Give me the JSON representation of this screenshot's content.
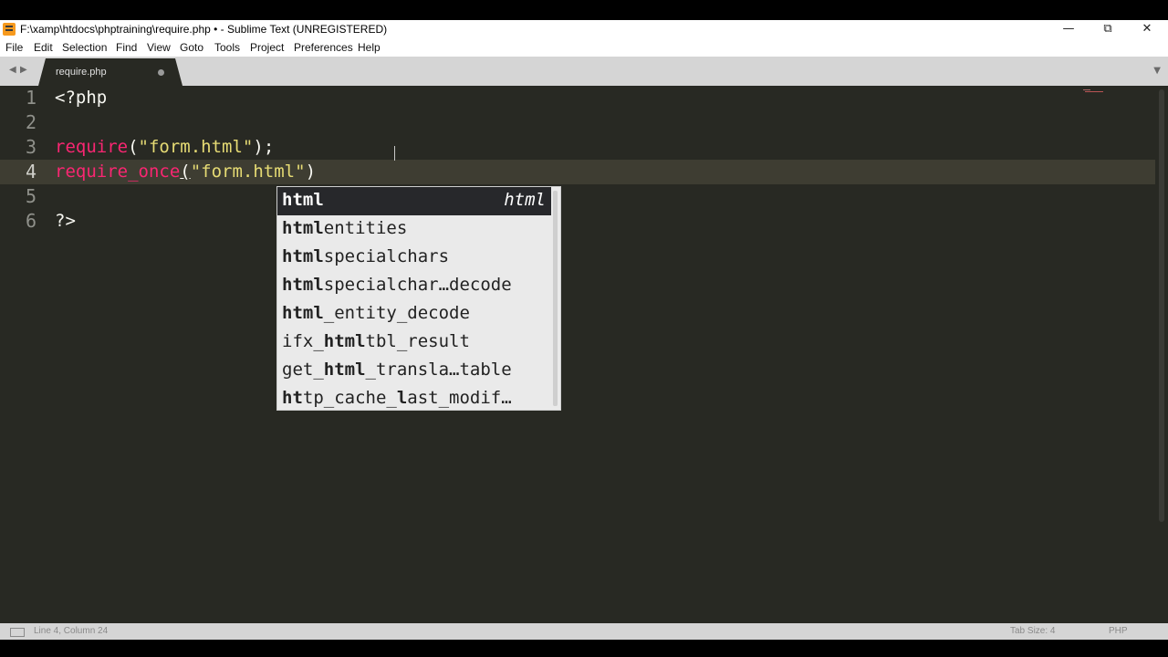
{
  "window": {
    "title": "F:\\xamp\\htdocs\\phptraining\\require.php • - Sublime Text (UNREGISTERED)",
    "minimize_icon": "minimize-icon",
    "restore_icon": "restore-icon",
    "close_icon": "close-icon"
  },
  "menu": [
    "File",
    "Edit",
    "Selection",
    "Find",
    "View",
    "Goto",
    "Tools",
    "Project",
    "Preferences",
    "Help"
  ],
  "tabs": [
    {
      "label": "require.php",
      "dirty": true
    }
  ],
  "editor": {
    "line_numbers": [
      "1",
      "2",
      "3",
      "4",
      "5",
      "6"
    ],
    "current_line": "4",
    "lines": {
      "l1": "<?php",
      "l3_fn": "require",
      "l3_open": "(",
      "l3_str": "\"form.html\"",
      "l3_close": ");",
      "l4_fn": "require_once",
      "l4_open": "(",
      "l4_str": "\"form.html\"",
      "l4_close": ")",
      "l6": "?>"
    }
  },
  "autocomplete": {
    "items": [
      {
        "bold": "html",
        "rest": "",
        "annotation": "html"
      },
      {
        "bold": "html",
        "rest": "entities"
      },
      {
        "bold": "html",
        "rest": "specialchars"
      },
      {
        "bold": "html",
        "rest": "specialchar…decode"
      },
      {
        "bold": "html",
        "rest": "_entity_decode"
      },
      {
        "pre": "ifx_",
        "bold": "html",
        "rest": "tbl_result"
      },
      {
        "pre": "get_",
        "bold": "html",
        "rest": "_transla…table"
      },
      {
        "b1": "ht",
        "m1": "tp_cache_",
        "b2": "l",
        "m2": "ast_modif…"
      }
    ]
  },
  "status": {
    "position": "Line 4, Column 24",
    "tab_size": "Tab Size: 4",
    "syntax": "PHP"
  },
  "colors": {
    "editor_bg": "#282923",
    "keyword": "#f92672",
    "string": "#e6db74",
    "popup_bg": "#eaeaea",
    "popup_selected": "#27282b"
  }
}
